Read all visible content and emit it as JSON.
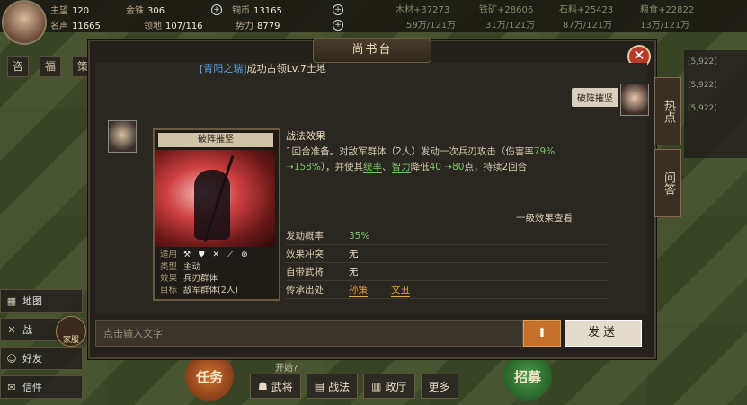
{
  "resources": {
    "prestige_label": "主望",
    "prestige_value": "120",
    "gold_label": "金铢",
    "gold_value": "306",
    "copper_label": "铜币",
    "copper_value": "13165",
    "fame_label": "名声",
    "fame_value": "11665",
    "land_label": "领地",
    "land_value": "107/116",
    "power_label": "势力",
    "power_value": "8779"
  },
  "top_right": {
    "wood": "木材+37273",
    "iron": "铁矿+28606",
    "stone": "石料+25423",
    "grain": "粮食+22822",
    "wood_cap": "59万/121万",
    "iron_cap": "31万/121万",
    "stone_cap": "87万/121万",
    "grain_cap": "13万/121万"
  },
  "side_tabs": [
    "咨",
    "福",
    "策"
  ],
  "right_column": [
    "(5,922)",
    "(5,922)",
    "(5,922)"
  ],
  "top_right_labels": [
    "人",
    "地",
    "陆"
  ],
  "left_menu": [
    {
      "icon": "▦",
      "label": "地图"
    },
    {
      "icon": "✕",
      "label": "战"
    },
    {
      "icon": "☺",
      "label": "好友"
    },
    {
      "icon": "✉",
      "label": "信件"
    }
  ],
  "home_label": "家服",
  "bottom": {
    "task": "任务",
    "recruit": "招募",
    "hint": "开始?",
    "buttons": [
      "武将",
      "战法",
      "政厅",
      "更多"
    ]
  },
  "dialog": {
    "title": "尚书台",
    "announcement_prefix": "[青阳之瑞]",
    "announcement_text": "成功占领Lv.7土地",
    "side_tab_hot": "热点",
    "side_tab_qa": "问答",
    "right_bubble": "破阵摧坚",
    "card": {
      "name": "破阵摧坚",
      "info": [
        {
          "k": "适用",
          "v": "⚒ ⛊ ✕ ⟋ ⊛"
        },
        {
          "k": "类型",
          "v": "主动"
        },
        {
          "k": "效果",
          "v": "兵刃群体"
        },
        {
          "k": "目标",
          "v": "敌军群体(2人)"
        }
      ]
    },
    "effect": {
      "title": "战法效果",
      "desc_1": "1回合准备。对敌军群体（2人）发动一次兵刃攻击（伤害率",
      "rate_a": "79%",
      "rate_arrow": " ➝",
      "rate_b": "158%",
      "desc_2": "），并使其",
      "stat_a": "统率",
      "desc_3": "、",
      "stat_b": "智力",
      "desc_4": "降低",
      "val_a": "40",
      "val_arrow": " ➝",
      "val_b": "80",
      "desc_5": "点，持续2回合",
      "link": "一级效果查看"
    },
    "props": [
      {
        "k": "发动概率",
        "v": "35%"
      },
      {
        "k": "效果冲突",
        "v": "无"
      },
      {
        "k": "自带武将",
        "v": "无"
      },
      {
        "k": "传承出处",
        "v1": "孙策",
        "v2": "文丑"
      }
    ],
    "input_placeholder": "点击输入文字",
    "send_label": "发送",
    "up_label": "⬆"
  }
}
